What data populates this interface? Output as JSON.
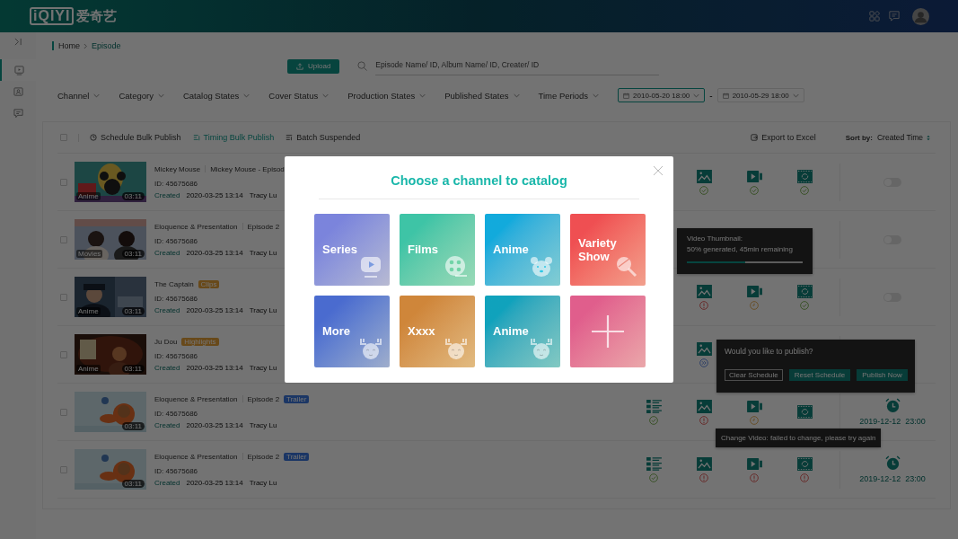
{
  "header": {
    "logo": "iQIYI",
    "logo_cn": "爱奇艺"
  },
  "sidebar": {
    "items": [
      {
        "kind": "video",
        "selected": true
      },
      {
        "kind": "profile",
        "selected": false
      },
      {
        "kind": "message",
        "selected": false
      }
    ]
  },
  "breadcrumb": [
    "Home",
    "Episode"
  ],
  "upload_button": "Upload",
  "search": {
    "placeholder": "Episode Name/ ID, Album Name/ ID, Creater/ ID"
  },
  "filters": [
    "Channel",
    "Category",
    "Catalog States",
    "Cover Status",
    "Production States",
    "Published States",
    "Time Periods"
  ],
  "date_range": {
    "separator": "-",
    "fields": [
      {
        "value": "2010-05-20 18:00",
        "selected": true
      },
      {
        "value": "2010-05-29 18:00",
        "selected": false
      }
    ]
  },
  "toolbar": {
    "select_all": {
      "checked": false
    },
    "actions": [
      {
        "label": "Schedule Bulk Publish",
        "kind": "clock",
        "selected": false
      },
      {
        "label": "Timing Bulk Publish",
        "kind": "timing",
        "selected": true
      },
      {
        "label": "Batch Suspended",
        "kind": "suspend",
        "selected": false
      }
    ],
    "export": "Export to Excel",
    "sort_label": "Sort by:",
    "sort_value": "Created Time"
  },
  "rows": [
    {
      "checked": false,
      "thumbnail": {
        "category": "Anime",
        "duration": "03:11"
      },
      "title": "Mickey Mouse",
      "subtitle": "Mickey Mouse - Episod",
      "id": "ID: 45675686",
      "status": "Created",
      "date": "2020-03-25 13:14",
      "author": "Tracy Lu",
      "icons": {
        "cover": {
          "kind": "ok"
        },
        "video": {
          "kind": "ok"
        },
        "thumbnail": {
          "kind": "ok"
        }
      },
      "publish": {
        "kind": "toggle",
        "on": false
      }
    },
    {
      "checked": false,
      "thumbnail": {
        "category": "Movies",
        "duration": "03:11"
      },
      "title": "Eloquence & Presentation",
      "subtitle": "Episode 2",
      "id": "ID: 45675686",
      "status": "Created",
      "date": "2020-03-25 13:14",
      "author": "Tracy Lu",
      "publish": {
        "kind": "toggle",
        "on": false
      }
    },
    {
      "checked": false,
      "thumbnail": {
        "category": "Anime",
        "duration": "03:11"
      },
      "title": "The Captain",
      "tag": {
        "label": "Clips",
        "color": "#68491a"
      },
      "id": "ID: 45675686",
      "status": "Created",
      "date": "2020-03-25 13:14",
      "author": "Tracy Lu",
      "icons": {
        "cover": {
          "kind": "error"
        },
        "video": {
          "kind": "pending"
        },
        "thumbnail": {
          "kind": "ok"
        }
      },
      "publish": {
        "kind": "toggle",
        "on": false
      }
    },
    {
      "checked": false,
      "thumbnail": {
        "category": "Anime",
        "duration": "03:11"
      },
      "title": "Ju Dou",
      "tag": {
        "label": "Highlights",
        "color": "#68491a"
      },
      "id": "ID: 45675686",
      "status": "Created",
      "date": "2020-03-25 13:14",
      "author": "Tracy Lu",
      "icons": {
        "cover": {
          "kind": "forward"
        }
      }
    },
    {
      "checked": false,
      "thumbnail": {
        "duration": "03:11"
      },
      "title": "Eloquence & Presentation",
      "subtitle": "Episode 2",
      "tag": {
        "label": "Trailer",
        "color": "#1b3665"
      },
      "id": "ID: 45675686",
      "status": "Created",
      "date": "2020-03-25 13:14",
      "author": "Tracy Lu",
      "icons": {
        "catalog": {
          "kind": "ok"
        },
        "cover": {
          "kind": "error"
        },
        "video": {
          "kind": "pending"
        },
        "thumbnail": {
          "kind": "none"
        }
      },
      "publish": {
        "kind": "schedule",
        "time": "2019-12-12  23:00"
      }
    },
    {
      "checked": false,
      "thumbnail": {
        "duration": "03:11"
      },
      "title": "Eloquence & Presentation",
      "subtitle": "Episode 2",
      "tag": {
        "label": "Trailer",
        "color": "#1b3665"
      },
      "id": "ID: 45675686",
      "status": "Created",
      "date": "2020-03-25 13:14",
      "author": "Tracy Lu",
      "icons": {
        "catalog": {
          "kind": "ok"
        },
        "cover": {
          "kind": "error"
        },
        "video": {
          "kind": "error"
        },
        "thumbnail": {
          "kind": "error"
        }
      },
      "publish": {
        "kind": "schedule",
        "time": "2019-12-12  23:00"
      }
    }
  ],
  "progress_tooltip": {
    "title": "Video Thumbnail:",
    "text": "50% generated, 45min remaining",
    "level": 0.5
  },
  "publish_popover": {
    "question": "Would you like to publish?",
    "buttons": [
      {
        "label": "Clear Schedule",
        "kind": "outline"
      },
      {
        "label": "Reset Schedule",
        "kind": "primary"
      },
      {
        "label": "Publish Now",
        "kind": "primary"
      }
    ]
  },
  "error_tooltip": {
    "text": "Change Video: failed to change, please try again"
  },
  "modal": {
    "title": "Choose a channel to catalog",
    "tiles": [
      {
        "label": "Series",
        "kind": "tv",
        "color": "#7b84dc"
      },
      {
        "label": "Films",
        "kind": "reel",
        "color": "#3ec4a6"
      },
      {
        "label": "Anime",
        "kind": "bear",
        "color": "#12aadc"
      },
      {
        "label": "Variety Show",
        "kind": "lollipop",
        "color": "#ef4f52"
      },
      {
        "label": "More",
        "kind": "moose",
        "color": "#4a6bcf"
      },
      {
        "label": "Xxxx",
        "kind": "moose",
        "color": "#cf863a"
      },
      {
        "label": "Anime",
        "kind": "moose",
        "color": "#10a2bc"
      },
      {
        "kind": "plus",
        "color": "#e05e8c"
      }
    ]
  }
}
